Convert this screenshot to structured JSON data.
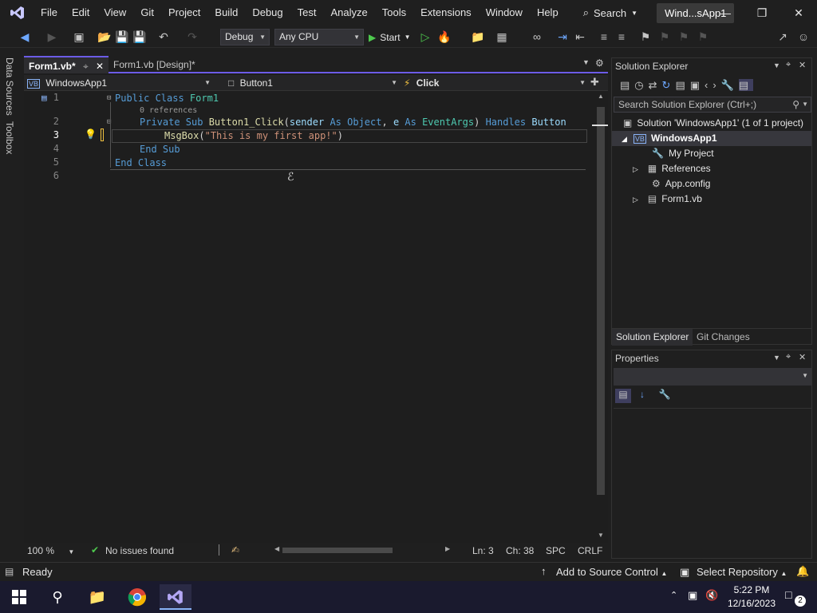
{
  "menubar": {
    "items": [
      "File",
      "Edit",
      "View",
      "Git",
      "Project",
      "Build",
      "Debug",
      "Test",
      "Analyze",
      "Tools",
      "Extensions",
      "Window",
      "Help"
    ],
    "search_label": "Search",
    "window_title": "Wind...sApp1"
  },
  "toolbar": {
    "config": "Debug",
    "platform": "Any CPU",
    "start_label": "Start"
  },
  "left_tabs": [
    "Data Sources",
    "Toolbox"
  ],
  "editor": {
    "tabs": [
      {
        "label": "Form1.vb*"
      },
      {
        "label": "Form1.vb [Design]*"
      }
    ],
    "nav": {
      "project": "WindowsApp1",
      "object": "Button1",
      "event": "Click"
    },
    "line_numbers": [
      "1",
      "2",
      "3",
      "4",
      "5",
      "6"
    ],
    "references": "0 references",
    "status": {
      "zoom": "100 %",
      "issues": "No issues found",
      "ln": "Ln: 3",
      "ch": "Ch: 38",
      "spc": "SPC",
      "crlf": "CRLF"
    }
  },
  "code": {
    "l1": {
      "a": "Public Class ",
      "b": "Form1"
    },
    "l2": {
      "a": "Private Sub ",
      "b": "Button1_Click",
      "c": "(",
      "d": "sender",
      "e": " As ",
      "f": "Object",
      "g": ", ",
      "h": "e",
      "i": " As ",
      "j": "EventArgs",
      "k": ") ",
      "l": "Handles ",
      "m": "Button"
    },
    "l3": {
      "a": "MsgBox",
      "b": "(",
      "c": "\"This is my first app!\"",
      "d": ")"
    },
    "l4": {
      "a": "End Sub"
    },
    "l5": {
      "a": "End Class"
    }
  },
  "solution_explorer": {
    "title": "Solution Explorer",
    "search_placeholder": "Search Solution Explorer (Ctrl+;)",
    "items": [
      {
        "label": "Solution 'WindowsApp1' (1 of 1 project)"
      },
      {
        "label": "WindowsApp1"
      },
      {
        "label": "My Project"
      },
      {
        "label": "References"
      },
      {
        "label": "App.config"
      },
      {
        "label": "Form1.vb"
      }
    ],
    "tabs": [
      "Solution Explorer",
      "Git Changes"
    ]
  },
  "properties": {
    "title": "Properties"
  },
  "statusbar": {
    "ready": "Ready",
    "source_control": "Add to Source Control",
    "repository": "Select Repository"
  },
  "taskbar": {
    "time": "5:22 PM",
    "date": "12/16/2023",
    "notification_count": "2"
  },
  "colors": {
    "accent": "#6c5ce7",
    "keyword": "#569cd6",
    "type": "#4ec9b0",
    "function": "#dcdcaa",
    "string": "#ce9178"
  }
}
